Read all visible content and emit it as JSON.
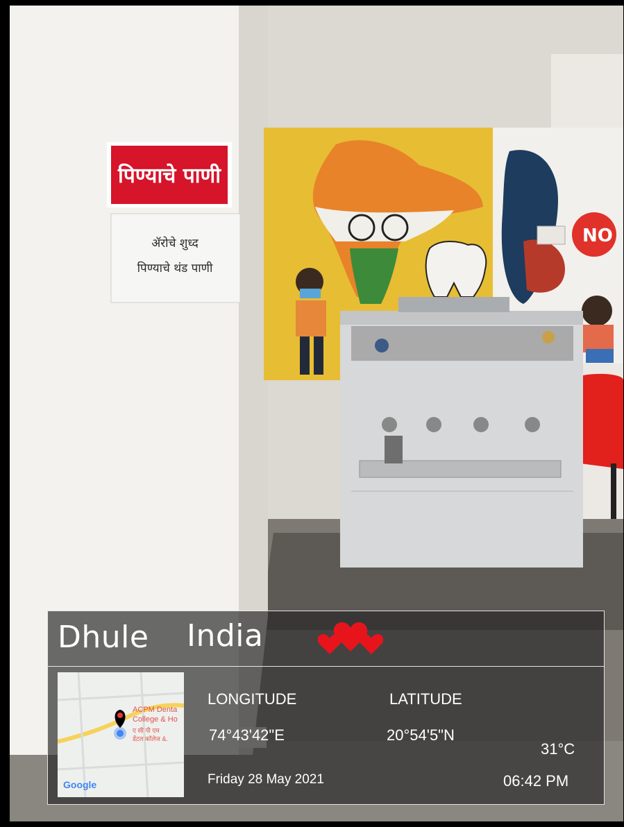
{
  "location": {
    "city": "Dhule",
    "country": "India"
  },
  "coordinates": {
    "longitude_label": "LONGITUDE",
    "latitude_label": "LATITUDE",
    "longitude_value": "74°43'42\"E",
    "latitude_value": "20°54'5\"N"
  },
  "weather": {
    "temperature": "31°C"
  },
  "datetime": {
    "date": "Friday 28 May 2021",
    "time": "06:42 PM"
  },
  "map": {
    "place_label_line1": "ACPM Denta",
    "place_label_line2": "College & Ho",
    "place_label_line3": "ए सी पी एम",
    "place_label_line4": "डेंटल कॉलेज &.",
    "brand": "Google",
    "pin_color": "#000000",
    "marker_color": "#4285f4"
  },
  "signs": {
    "red_sign_text": "पिण्याचे पाणी",
    "paper_line1": "ॲरोचे शुध्द",
    "paper_line2": "पिण्याचे थंड पाणी",
    "red_sign_color": "#d6142a"
  },
  "accent_colors": {
    "hearts": "#e8141c"
  }
}
